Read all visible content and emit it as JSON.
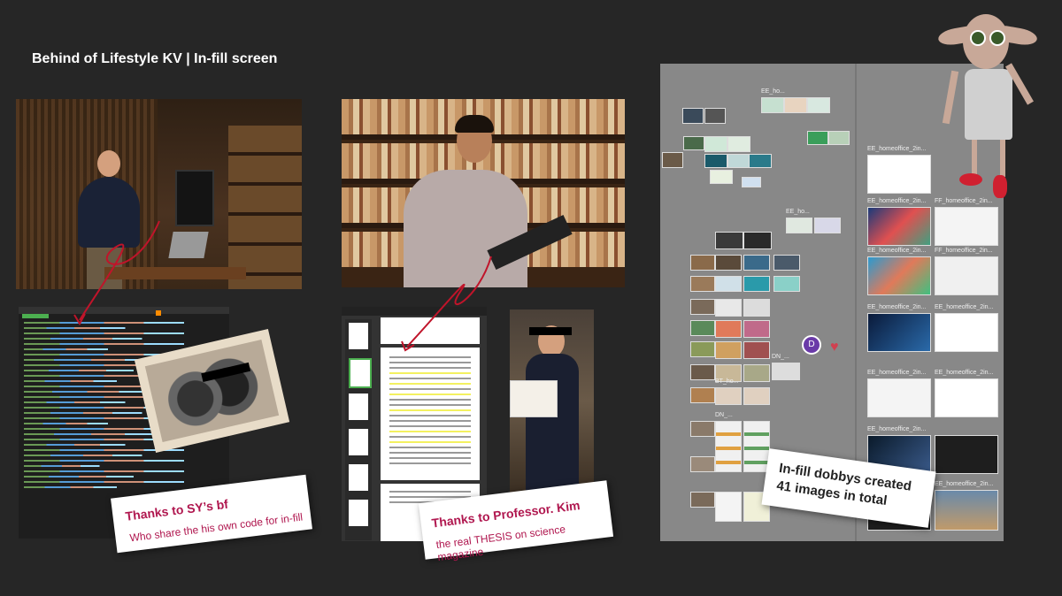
{
  "title": "Behind of Lifestyle KV | In-fill screen",
  "notes": {
    "bf": {
      "heading": "Thanks to SY’s bf",
      "sub": "Who share the his own code for in-fill"
    },
    "prof": {
      "heading": "Thanks to Professor. Kim",
      "sub": "the real THESIS on science magazine"
    },
    "dobby": {
      "line1": "In-fill dobbys created",
      "line2": "41 images in total"
    }
  },
  "board_labels": {
    "ee_homeoffice": "EE_homeoffice_2in...",
    "ff_homeoffice": "FF_homeoffice_2in...",
    "avatar_letter": "D",
    "ee_ho": "EE_ho...",
    "dn": "DN_...",
    "bt_ho": "BT_ho..."
  },
  "colors": {
    "accent": "#b0174f",
    "background": "#262626",
    "board": "#888888"
  }
}
